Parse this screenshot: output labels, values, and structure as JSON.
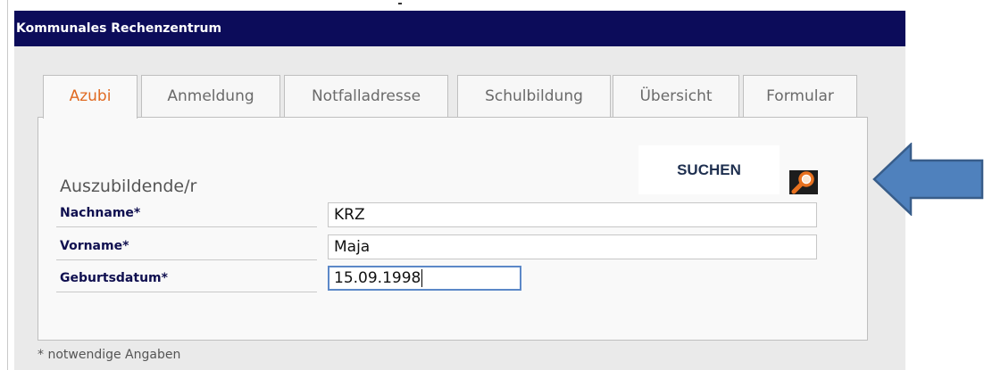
{
  "header": {
    "title": "Kommunales Rechenzentrum"
  },
  "tabs": [
    {
      "label": "Azubi",
      "active": true
    },
    {
      "label": "Anmeldung",
      "active": false
    },
    {
      "label": "Notfalladresse",
      "active": false
    },
    {
      "label": "Schulbildung",
      "active": false
    },
    {
      "label": "Übersicht",
      "active": false
    },
    {
      "label": "Formular",
      "active": false
    }
  ],
  "form": {
    "section_title": "Auszubildende/r",
    "fields": [
      {
        "label": "Nachname*",
        "value": "KRZ"
      },
      {
        "label": "Vorname*",
        "value": "Maja"
      },
      {
        "label": "Geburtsdatum*",
        "value": "15.09.1998"
      }
    ]
  },
  "search": {
    "label": "SUCHEN",
    "icon": "search-icon"
  },
  "footnote": "* notwendige Angaben",
  "colors": {
    "header_bg": "#0c0c5a",
    "active_tab_text": "#e06a22",
    "arrow_fill": "#4f81bd",
    "focused_border": "#5c88c8"
  }
}
